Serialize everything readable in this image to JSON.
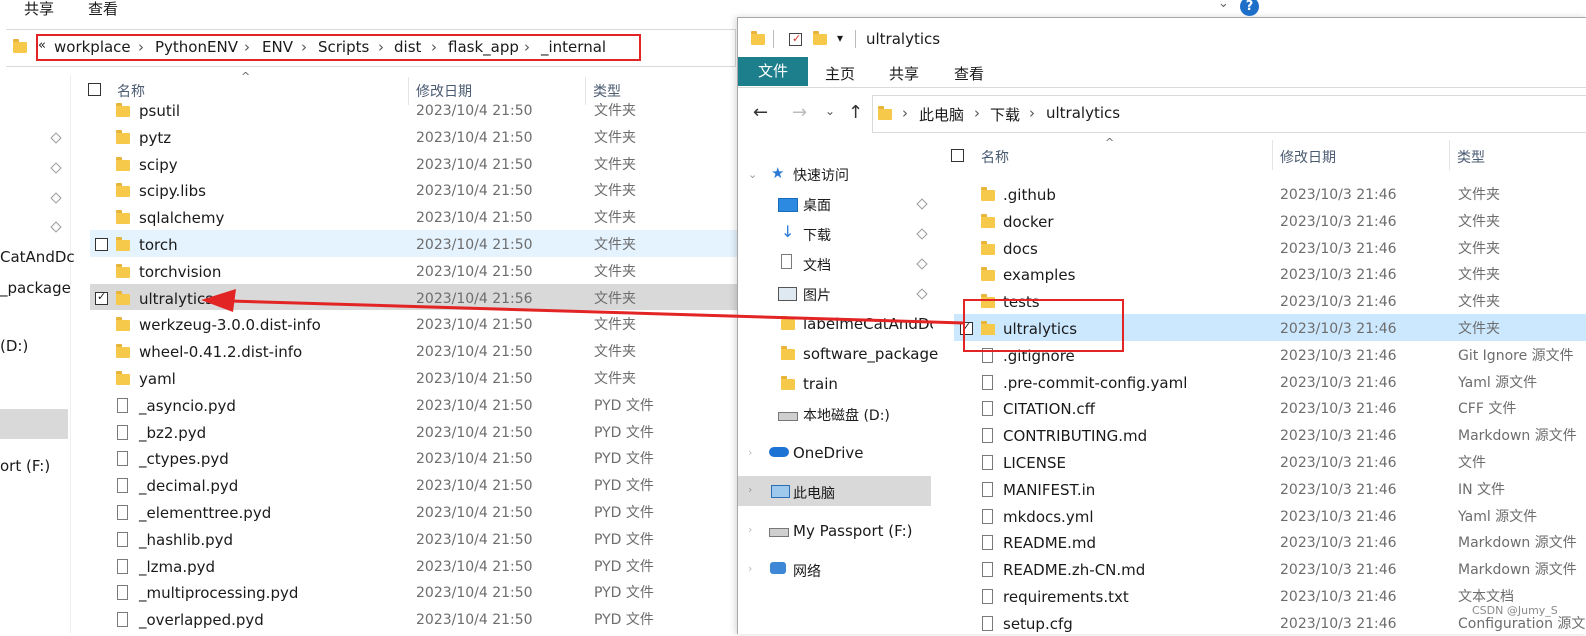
{
  "left_window": {
    "ribbon_tabs": [
      "共享",
      "查看"
    ],
    "breadcrumb": [
      "workplace",
      "PythonENV",
      "ENV",
      "Scripts",
      "dist",
      "flask_app",
      "_internal"
    ],
    "breadcrumb_overflow": "«",
    "columns": {
      "name": "名称",
      "date": "修改日期",
      "type": "类型"
    },
    "sidebar_fragments": [
      "CatAndDc",
      "_package",
      "(D:)",
      "ort (F:)"
    ],
    "files": [
      {
        "name": "psutil",
        "date": "2023/10/4 21:50",
        "type": "文件夹",
        "kind": "folder"
      },
      {
        "name": "pytz",
        "date": "2023/10/4 21:50",
        "type": "文件夹",
        "kind": "folder"
      },
      {
        "name": "scipy",
        "date": "2023/10/4 21:50",
        "type": "文件夹",
        "kind": "folder"
      },
      {
        "name": "scipy.libs",
        "date": "2023/10/4 21:50",
        "type": "文件夹",
        "kind": "folder"
      },
      {
        "name": "sqlalchemy",
        "date": "2023/10/4 21:50",
        "type": "文件夹",
        "kind": "folder"
      },
      {
        "name": "torch",
        "date": "2023/10/4 21:50",
        "type": "文件夹",
        "kind": "folder"
      },
      {
        "name": "torchvision",
        "date": "2023/10/4 21:50",
        "type": "文件夹",
        "kind": "folder"
      },
      {
        "name": "ultralytics",
        "date": "2023/10/4 21:56",
        "type": "文件夹",
        "kind": "folder"
      },
      {
        "name": "werkzeug-3.0.0.dist-info",
        "date": "2023/10/4 21:50",
        "type": "文件夹",
        "kind": "folder"
      },
      {
        "name": "wheel-0.41.2.dist-info",
        "date": "2023/10/4 21:50",
        "type": "文件夹",
        "kind": "folder"
      },
      {
        "name": "yaml",
        "date": "2023/10/4 21:50",
        "type": "文件夹",
        "kind": "folder"
      },
      {
        "name": "_asyncio.pyd",
        "date": "2023/10/4 21:50",
        "type": "PYD 文件",
        "kind": "file"
      },
      {
        "name": "_bz2.pyd",
        "date": "2023/10/4 21:50",
        "type": "PYD 文件",
        "kind": "file"
      },
      {
        "name": "_ctypes.pyd",
        "date": "2023/10/4 21:50",
        "type": "PYD 文件",
        "kind": "file"
      },
      {
        "name": "_decimal.pyd",
        "date": "2023/10/4 21:50",
        "type": "PYD 文件",
        "kind": "file"
      },
      {
        "name": "_elementtree.pyd",
        "date": "2023/10/4 21:50",
        "type": "PYD 文件",
        "kind": "file"
      },
      {
        "name": "_hashlib.pyd",
        "date": "2023/10/4 21:50",
        "type": "PYD 文件",
        "kind": "file"
      },
      {
        "name": "_lzma.pyd",
        "date": "2023/10/4 21:50",
        "type": "PYD 文件",
        "kind": "file"
      },
      {
        "name": "_multiprocessing.pyd",
        "date": "2023/10/4 21:50",
        "type": "PYD 文件",
        "kind": "file"
      },
      {
        "name": "_overlapped.pyd",
        "date": "2023/10/4 21:50",
        "type": "PYD 文件",
        "kind": "file"
      }
    ]
  },
  "right_window": {
    "title": "ultralytics",
    "ribbon_tabs": [
      "文件",
      "主页",
      "共享",
      "查看"
    ],
    "breadcrumb": [
      "此电脑",
      "下载",
      "ultralytics"
    ],
    "columns": {
      "name": "名称",
      "date": "修改日期",
      "type": "类型"
    },
    "nav": {
      "quick_access": "快速访问",
      "items": [
        "桌面",
        "下载",
        "文档",
        "图片",
        "labelmeCatAndDc",
        "software_package",
        "train",
        "本地磁盘 (D:)"
      ],
      "onedrive": "OneDrive",
      "this_pc": "此电脑",
      "passport": "My Passport (F:)",
      "network": "网络"
    },
    "files": [
      {
        "name": ".github",
        "date": "2023/10/3 21:46",
        "type": "文件夹",
        "kind": "folder"
      },
      {
        "name": "docker",
        "date": "2023/10/3 21:46",
        "type": "文件夹",
        "kind": "folder"
      },
      {
        "name": "docs",
        "date": "2023/10/3 21:46",
        "type": "文件夹",
        "kind": "folder"
      },
      {
        "name": "examples",
        "date": "2023/10/3 21:46",
        "type": "文件夹",
        "kind": "folder"
      },
      {
        "name": "tests",
        "date": "2023/10/3 21:46",
        "type": "文件夹",
        "kind": "folder"
      },
      {
        "name": "ultralytics",
        "date": "2023/10/3 21:46",
        "type": "文件夹",
        "kind": "folder"
      },
      {
        "name": ".gitignore",
        "date": "2023/10/3 21:46",
        "type": "Git Ignore 源文件",
        "kind": "file"
      },
      {
        "name": ".pre-commit-config.yaml",
        "date": "2023/10/3 21:46",
        "type": "Yaml 源文件",
        "kind": "file"
      },
      {
        "name": "CITATION.cff",
        "date": "2023/10/3 21:46",
        "type": "CFF 文件",
        "kind": "file"
      },
      {
        "name": "CONTRIBUTING.md",
        "date": "2023/10/3 21:46",
        "type": "Markdown 源文件",
        "kind": "file"
      },
      {
        "name": "LICENSE",
        "date": "2023/10/3 21:46",
        "type": "文件",
        "kind": "file"
      },
      {
        "name": "MANIFEST.in",
        "date": "2023/10/3 21:46",
        "type": "IN 文件",
        "kind": "file"
      },
      {
        "name": "mkdocs.yml",
        "date": "2023/10/3 21:46",
        "type": "Yaml 源文件",
        "kind": "file"
      },
      {
        "name": "README.md",
        "date": "2023/10/3 21:46",
        "type": "Markdown 源文件",
        "kind": "file"
      },
      {
        "name": "README.zh-CN.md",
        "date": "2023/10/3 21:46",
        "type": "Markdown 源文件",
        "kind": "file"
      },
      {
        "name": "requirements.txt",
        "date": "2023/10/3 21:46",
        "type": "文本文档",
        "kind": "file"
      },
      {
        "name": "setup.cfg",
        "date": "2023/10/3 21:46",
        "type": "Configuration 源文件",
        "kind": "file"
      }
    ]
  },
  "watermark": "CSDN @Jumy_S",
  "colors": {
    "annotation_red": "#e32424",
    "selection_blue": "#cce8ff",
    "ribbon_file_tab": "#1e7f8c"
  }
}
